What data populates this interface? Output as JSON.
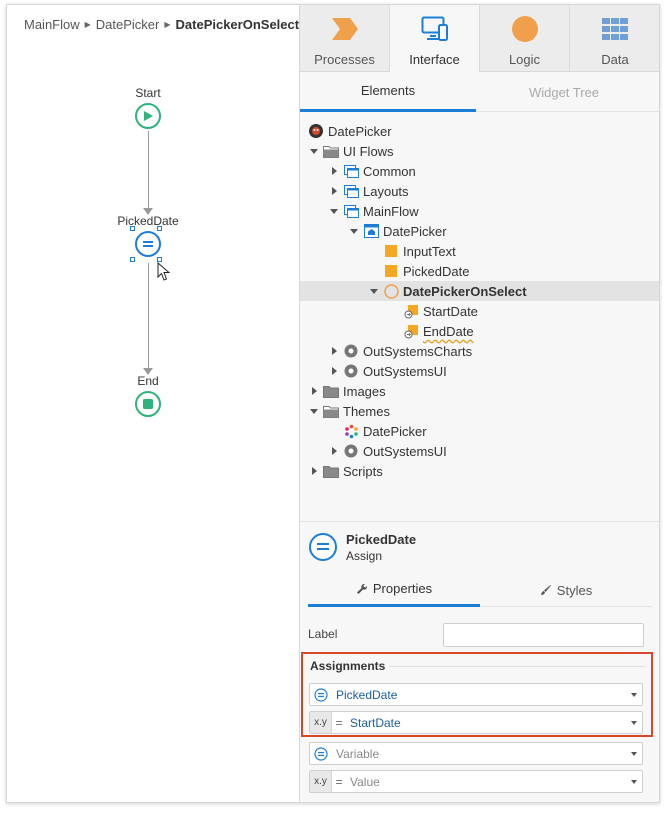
{
  "breadcrumb": {
    "items": [
      "MainFlow",
      "DatePicker"
    ],
    "current": "DatePickerOnSelect"
  },
  "flow": {
    "start_label": "Start",
    "assign_label": "PickedDate",
    "end_label": "End"
  },
  "top_tabs": [
    {
      "label": "Processes",
      "icon": "processes-icon",
      "active": false
    },
    {
      "label": "Interface",
      "icon": "interface-icon",
      "active": true
    },
    {
      "label": "Logic",
      "icon": "logic-icon",
      "active": false
    },
    {
      "label": "Data",
      "icon": "data-icon",
      "active": false
    }
  ],
  "sub_tabs": {
    "elements": "Elements",
    "widget_tree": "Widget Tree"
  },
  "tree": [
    {
      "label": "DatePicker",
      "icon": "module-icon",
      "caret": "none",
      "indent": 0
    },
    {
      "label": "UI Flows",
      "icon": "folder-icon",
      "caret": "down",
      "indent": 0
    },
    {
      "label": "Common",
      "icon": "ui-flow-icon",
      "caret": "right",
      "indent": 1
    },
    {
      "label": "Layouts",
      "icon": "ui-flow-icon",
      "caret": "right",
      "indent": 1
    },
    {
      "label": "MainFlow",
      "icon": "ui-flow-icon",
      "caret": "down",
      "indent": 1
    },
    {
      "label": "DatePicker",
      "icon": "screen-icon",
      "caret": "down",
      "indent": 2
    },
    {
      "label": "InputText",
      "icon": "variable-icon",
      "caret": "none",
      "indent": 3
    },
    {
      "label": "PickedDate",
      "icon": "variable-icon",
      "caret": "none",
      "indent": 3
    },
    {
      "label": "DatePickerOnSelect",
      "icon": "action-icon",
      "caret": "down",
      "indent": 3,
      "selected": true
    },
    {
      "label": "StartDate",
      "icon": "input-param-icon",
      "caret": "none",
      "indent": 4
    },
    {
      "label": "EndDate",
      "icon": "input-param-icon",
      "caret": "none",
      "indent": 4,
      "warning": true
    },
    {
      "label": "OutSystemsCharts",
      "icon": "reference-icon",
      "caret": "right",
      "indent": 1
    },
    {
      "label": "OutSystemsUI",
      "icon": "reference-icon",
      "caret": "right",
      "indent": 1
    },
    {
      "label": "Images",
      "icon": "folder-icon",
      "caret": "right",
      "indent": 0
    },
    {
      "label": "Themes",
      "icon": "folder-icon",
      "caret": "down",
      "indent": 0
    },
    {
      "label": "DatePicker",
      "icon": "theme-icon",
      "caret": "none",
      "indent": 1
    },
    {
      "label": "OutSystemsUI",
      "icon": "reference-icon",
      "caret": "right",
      "indent": 1
    },
    {
      "label": "Scripts",
      "icon": "folder-icon",
      "caret": "right",
      "indent": 0
    }
  ],
  "properties": {
    "name": "PickedDate",
    "type": "Assign",
    "tabs": {
      "properties": "Properties",
      "styles": "Styles"
    },
    "label_field": {
      "label": "Label",
      "value": ""
    },
    "assignments_title": "Assignments",
    "assignments": [
      {
        "variable": "PickedDate",
        "value": "StartDate"
      }
    ],
    "empty_row": {
      "variable_placeholder": "Variable",
      "value_placeholder": "Value"
    },
    "xy_label": "x.y",
    "eq_label": "="
  },
  "colors": {
    "accent": "#1c7ed6",
    "start_end": "#2db37c",
    "highlight_border": "#d9472b",
    "processes": "#f0a04b",
    "logic": "#f0a04b",
    "folder": "#777777",
    "variable": "#f5a623"
  }
}
